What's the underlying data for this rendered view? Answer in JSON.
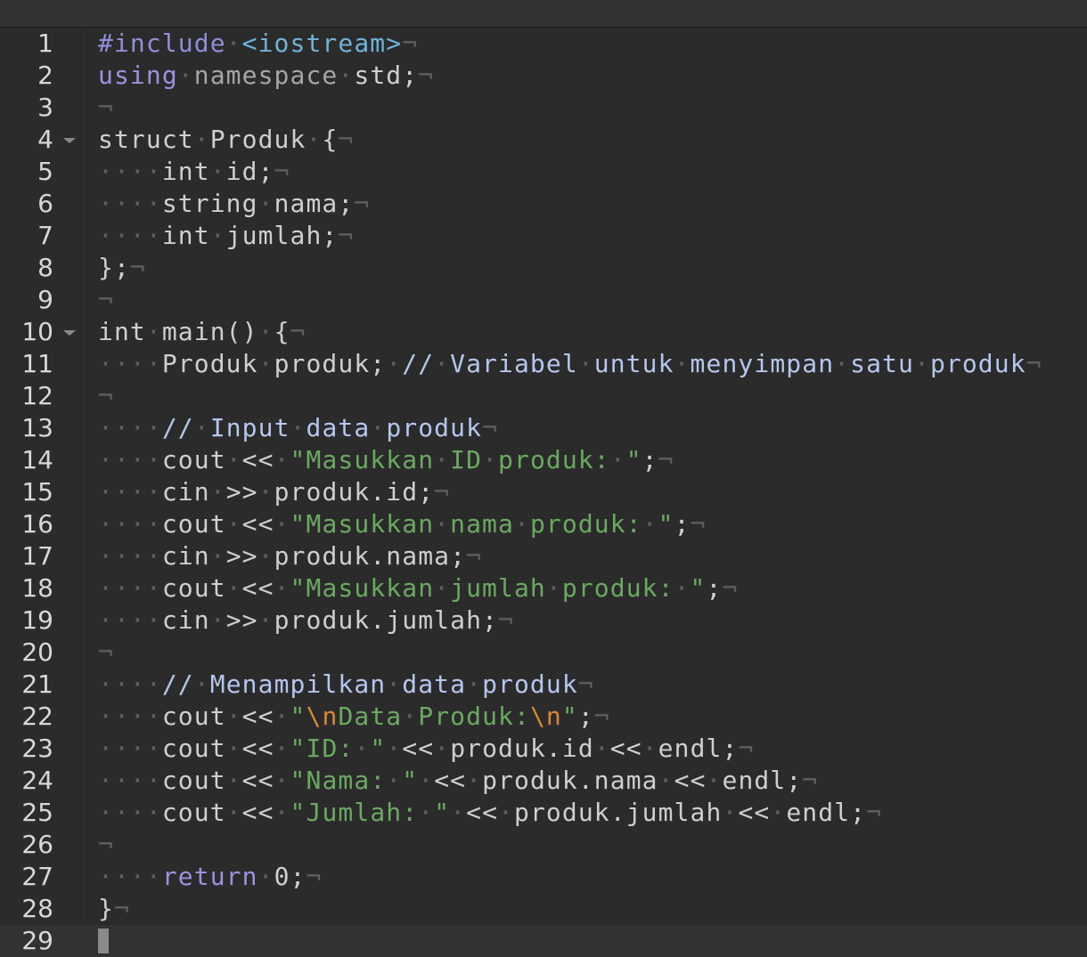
{
  "editor": {
    "lines": [
      {
        "n": "1",
        "tokens": [
          {
            "t": "#include",
            "c": "pre"
          },
          {
            "t": "·",
            "c": "ws"
          },
          {
            "t": "<iostream>",
            "c": "inc"
          },
          {
            "t": "¬",
            "c": "ws"
          }
        ]
      },
      {
        "n": "2",
        "tokens": [
          {
            "t": "using",
            "c": "kw"
          },
          {
            "t": "·",
            "c": "ws"
          },
          {
            "t": "namespace",
            "c": "dim"
          },
          {
            "t": "·",
            "c": "ws"
          },
          {
            "t": "std;",
            "c": "plain"
          },
          {
            "t": "¬",
            "c": "ws"
          }
        ]
      },
      {
        "n": "3",
        "tokens": [
          {
            "t": "¬",
            "c": "ws"
          }
        ]
      },
      {
        "n": "4",
        "fold": true,
        "tokens": [
          {
            "t": "struct",
            "c": "plain"
          },
          {
            "t": "·",
            "c": "ws"
          },
          {
            "t": "Produk",
            "c": "plain"
          },
          {
            "t": "·",
            "c": "ws"
          },
          {
            "t": "{",
            "c": "plain"
          },
          {
            "t": "¬",
            "c": "ws"
          }
        ]
      },
      {
        "n": "5",
        "tokens": [
          {
            "t": "····",
            "c": "ws"
          },
          {
            "t": "int",
            "c": "plain"
          },
          {
            "t": "·",
            "c": "ws"
          },
          {
            "t": "id;",
            "c": "plain"
          },
          {
            "t": "¬",
            "c": "ws"
          }
        ]
      },
      {
        "n": "6",
        "tokens": [
          {
            "t": "····",
            "c": "ws"
          },
          {
            "t": "string",
            "c": "plain"
          },
          {
            "t": "·",
            "c": "ws"
          },
          {
            "t": "nama;",
            "c": "plain"
          },
          {
            "t": "¬",
            "c": "ws"
          }
        ]
      },
      {
        "n": "7",
        "tokens": [
          {
            "t": "····",
            "c": "ws"
          },
          {
            "t": "int",
            "c": "plain"
          },
          {
            "t": "·",
            "c": "ws"
          },
          {
            "t": "jumlah;",
            "c": "plain"
          },
          {
            "t": "¬",
            "c": "ws"
          }
        ]
      },
      {
        "n": "8",
        "tokens": [
          {
            "t": "};",
            "c": "plain"
          },
          {
            "t": "¬",
            "c": "ws"
          }
        ]
      },
      {
        "n": "9",
        "tokens": [
          {
            "t": "¬",
            "c": "ws"
          }
        ]
      },
      {
        "n": "10",
        "fold": true,
        "tokens": [
          {
            "t": "int",
            "c": "plain"
          },
          {
            "t": "·",
            "c": "ws"
          },
          {
            "t": "main()",
            "c": "plain"
          },
          {
            "t": "·",
            "c": "ws"
          },
          {
            "t": "{",
            "c": "plain"
          },
          {
            "t": "¬",
            "c": "ws"
          }
        ]
      },
      {
        "n": "11",
        "tokens": [
          {
            "t": "····",
            "c": "ws"
          },
          {
            "t": "Produk",
            "c": "plain"
          },
          {
            "t": "·",
            "c": "ws"
          },
          {
            "t": "produk;",
            "c": "plain"
          },
          {
            "t": "·",
            "c": "ws"
          },
          {
            "t": "//",
            "c": "com"
          },
          {
            "t": "·",
            "c": "ws"
          },
          {
            "t": "Variabel",
            "c": "com"
          },
          {
            "t": "·",
            "c": "ws"
          },
          {
            "t": "untuk",
            "c": "com"
          },
          {
            "t": "·",
            "c": "ws"
          },
          {
            "t": "menyimpan",
            "c": "com"
          },
          {
            "t": "·",
            "c": "ws"
          },
          {
            "t": "satu",
            "c": "com"
          },
          {
            "t": "·",
            "c": "ws"
          },
          {
            "t": "produk",
            "c": "com"
          },
          {
            "t": "¬",
            "c": "ws"
          }
        ]
      },
      {
        "n": "12",
        "tokens": [
          {
            "t": "¬",
            "c": "ws"
          }
        ]
      },
      {
        "n": "13",
        "tokens": [
          {
            "t": "····",
            "c": "ws"
          },
          {
            "t": "//",
            "c": "com"
          },
          {
            "t": "·",
            "c": "ws"
          },
          {
            "t": "Input",
            "c": "com"
          },
          {
            "t": "·",
            "c": "ws"
          },
          {
            "t": "data",
            "c": "com"
          },
          {
            "t": "·",
            "c": "ws"
          },
          {
            "t": "produk",
            "c": "com"
          },
          {
            "t": "¬",
            "c": "ws"
          }
        ]
      },
      {
        "n": "14",
        "tokens": [
          {
            "t": "····",
            "c": "ws"
          },
          {
            "t": "cout",
            "c": "plain"
          },
          {
            "t": "·",
            "c": "ws"
          },
          {
            "t": "<<",
            "c": "plain"
          },
          {
            "t": "·",
            "c": "ws"
          },
          {
            "t": "\"Masukkan",
            "c": "str"
          },
          {
            "t": "·",
            "c": "ws"
          },
          {
            "t": "ID",
            "c": "str"
          },
          {
            "t": "·",
            "c": "ws"
          },
          {
            "t": "produk:",
            "c": "str"
          },
          {
            "t": "·",
            "c": "ws"
          },
          {
            "t": "\"",
            "c": "str"
          },
          {
            "t": ";",
            "c": "plain"
          },
          {
            "t": "¬",
            "c": "ws"
          }
        ]
      },
      {
        "n": "15",
        "tokens": [
          {
            "t": "····",
            "c": "ws"
          },
          {
            "t": "cin",
            "c": "plain"
          },
          {
            "t": "·",
            "c": "ws"
          },
          {
            "t": ">>",
            "c": "plain"
          },
          {
            "t": "·",
            "c": "ws"
          },
          {
            "t": "produk.id;",
            "c": "plain"
          },
          {
            "t": "¬",
            "c": "ws"
          }
        ]
      },
      {
        "n": "16",
        "tokens": [
          {
            "t": "····",
            "c": "ws"
          },
          {
            "t": "cout",
            "c": "plain"
          },
          {
            "t": "·",
            "c": "ws"
          },
          {
            "t": "<<",
            "c": "plain"
          },
          {
            "t": "·",
            "c": "ws"
          },
          {
            "t": "\"Masukkan",
            "c": "str"
          },
          {
            "t": "·",
            "c": "ws"
          },
          {
            "t": "nama",
            "c": "str"
          },
          {
            "t": "·",
            "c": "ws"
          },
          {
            "t": "produk:",
            "c": "str"
          },
          {
            "t": "·",
            "c": "ws"
          },
          {
            "t": "\"",
            "c": "str"
          },
          {
            "t": ";",
            "c": "plain"
          },
          {
            "t": "¬",
            "c": "ws"
          }
        ]
      },
      {
        "n": "17",
        "tokens": [
          {
            "t": "····",
            "c": "ws"
          },
          {
            "t": "cin",
            "c": "plain"
          },
          {
            "t": "·",
            "c": "ws"
          },
          {
            "t": ">>",
            "c": "plain"
          },
          {
            "t": "·",
            "c": "ws"
          },
          {
            "t": "produk.nama;",
            "c": "plain"
          },
          {
            "t": "¬",
            "c": "ws"
          }
        ]
      },
      {
        "n": "18",
        "tokens": [
          {
            "t": "····",
            "c": "ws"
          },
          {
            "t": "cout",
            "c": "plain"
          },
          {
            "t": "·",
            "c": "ws"
          },
          {
            "t": "<<",
            "c": "plain"
          },
          {
            "t": "·",
            "c": "ws"
          },
          {
            "t": "\"Masukkan",
            "c": "str"
          },
          {
            "t": "·",
            "c": "ws"
          },
          {
            "t": "jumlah",
            "c": "str"
          },
          {
            "t": "·",
            "c": "ws"
          },
          {
            "t": "produk:",
            "c": "str"
          },
          {
            "t": "·",
            "c": "ws"
          },
          {
            "t": "\"",
            "c": "str"
          },
          {
            "t": ";",
            "c": "plain"
          },
          {
            "t": "¬",
            "c": "ws"
          }
        ]
      },
      {
        "n": "19",
        "tokens": [
          {
            "t": "····",
            "c": "ws"
          },
          {
            "t": "cin",
            "c": "plain"
          },
          {
            "t": "·",
            "c": "ws"
          },
          {
            "t": ">>",
            "c": "plain"
          },
          {
            "t": "·",
            "c": "ws"
          },
          {
            "t": "produk.jumlah;",
            "c": "plain"
          },
          {
            "t": "¬",
            "c": "ws"
          }
        ]
      },
      {
        "n": "20",
        "tokens": [
          {
            "t": "¬",
            "c": "ws"
          }
        ]
      },
      {
        "n": "21",
        "tokens": [
          {
            "t": "····",
            "c": "ws"
          },
          {
            "t": "//",
            "c": "com"
          },
          {
            "t": "·",
            "c": "ws"
          },
          {
            "t": "Menampilkan",
            "c": "com"
          },
          {
            "t": "·",
            "c": "ws"
          },
          {
            "t": "data",
            "c": "com"
          },
          {
            "t": "·",
            "c": "ws"
          },
          {
            "t": "produk",
            "c": "com"
          },
          {
            "t": "¬",
            "c": "ws"
          }
        ]
      },
      {
        "n": "22",
        "tokens": [
          {
            "t": "····",
            "c": "ws"
          },
          {
            "t": "cout",
            "c": "plain"
          },
          {
            "t": "·",
            "c": "ws"
          },
          {
            "t": "<<",
            "c": "plain"
          },
          {
            "t": "·",
            "c": "ws"
          },
          {
            "t": "\"",
            "c": "str"
          },
          {
            "t": "\\n",
            "c": "esc"
          },
          {
            "t": "Data",
            "c": "str"
          },
          {
            "t": "·",
            "c": "ws"
          },
          {
            "t": "Produk:",
            "c": "str"
          },
          {
            "t": "\\n",
            "c": "esc"
          },
          {
            "t": "\"",
            "c": "str"
          },
          {
            "t": ";",
            "c": "plain"
          },
          {
            "t": "¬",
            "c": "ws"
          }
        ]
      },
      {
        "n": "23",
        "tokens": [
          {
            "t": "····",
            "c": "ws"
          },
          {
            "t": "cout",
            "c": "plain"
          },
          {
            "t": "·",
            "c": "ws"
          },
          {
            "t": "<<",
            "c": "plain"
          },
          {
            "t": "·",
            "c": "ws"
          },
          {
            "t": "\"ID:",
            "c": "str"
          },
          {
            "t": "·",
            "c": "ws"
          },
          {
            "t": "\"",
            "c": "str"
          },
          {
            "t": "·",
            "c": "ws"
          },
          {
            "t": "<<",
            "c": "plain"
          },
          {
            "t": "·",
            "c": "ws"
          },
          {
            "t": "produk.id",
            "c": "plain"
          },
          {
            "t": "·",
            "c": "ws"
          },
          {
            "t": "<<",
            "c": "plain"
          },
          {
            "t": "·",
            "c": "ws"
          },
          {
            "t": "endl;",
            "c": "plain"
          },
          {
            "t": "¬",
            "c": "ws"
          }
        ]
      },
      {
        "n": "24",
        "tokens": [
          {
            "t": "····",
            "c": "ws"
          },
          {
            "t": "cout",
            "c": "plain"
          },
          {
            "t": "·",
            "c": "ws"
          },
          {
            "t": "<<",
            "c": "plain"
          },
          {
            "t": "·",
            "c": "ws"
          },
          {
            "t": "\"Nama:",
            "c": "str"
          },
          {
            "t": "·",
            "c": "ws"
          },
          {
            "t": "\"",
            "c": "str"
          },
          {
            "t": "·",
            "c": "ws"
          },
          {
            "t": "<<",
            "c": "plain"
          },
          {
            "t": "·",
            "c": "ws"
          },
          {
            "t": "produk.nama",
            "c": "plain"
          },
          {
            "t": "·",
            "c": "ws"
          },
          {
            "t": "<<",
            "c": "plain"
          },
          {
            "t": "·",
            "c": "ws"
          },
          {
            "t": "endl;",
            "c": "plain"
          },
          {
            "t": "¬",
            "c": "ws"
          }
        ]
      },
      {
        "n": "25",
        "tokens": [
          {
            "t": "····",
            "c": "ws"
          },
          {
            "t": "cout",
            "c": "plain"
          },
          {
            "t": "·",
            "c": "ws"
          },
          {
            "t": "<<",
            "c": "plain"
          },
          {
            "t": "·",
            "c": "ws"
          },
          {
            "t": "\"Jumlah:",
            "c": "str"
          },
          {
            "t": "·",
            "c": "ws"
          },
          {
            "t": "\"",
            "c": "str"
          },
          {
            "t": "·",
            "c": "ws"
          },
          {
            "t": "<<",
            "c": "plain"
          },
          {
            "t": "·",
            "c": "ws"
          },
          {
            "t": "produk.jumlah",
            "c": "plain"
          },
          {
            "t": "·",
            "c": "ws"
          },
          {
            "t": "<<",
            "c": "plain"
          },
          {
            "t": "·",
            "c": "ws"
          },
          {
            "t": "endl;",
            "c": "plain"
          },
          {
            "t": "¬",
            "c": "ws"
          }
        ]
      },
      {
        "n": "26",
        "tokens": [
          {
            "t": "¬",
            "c": "ws"
          }
        ]
      },
      {
        "n": "27",
        "tokens": [
          {
            "t": "····",
            "c": "ws"
          },
          {
            "t": "return",
            "c": "kw"
          },
          {
            "t": "·",
            "c": "ws"
          },
          {
            "t": "0",
            "c": "num"
          },
          {
            "t": ";",
            "c": "plain"
          },
          {
            "t": "¬",
            "c": "ws"
          }
        ]
      },
      {
        "n": "28",
        "tokens": [
          {
            "t": "}",
            "c": "plain"
          },
          {
            "t": "¬",
            "c": "ws"
          }
        ]
      },
      {
        "n": "29",
        "active": true,
        "cursor": true,
        "tokens": []
      }
    ]
  }
}
